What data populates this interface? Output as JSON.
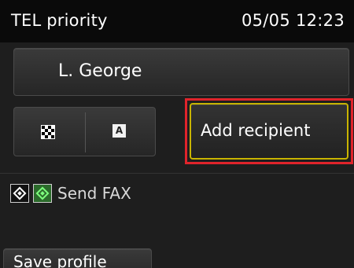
{
  "status_bar": {
    "title": "TEL priority",
    "datetime": "05/05 12:23"
  },
  "recipient": {
    "label": "L. George"
  },
  "scan_modes": {
    "left_icon": "checker-icon",
    "right_icon": "letter-a-icon",
    "right_icon_letter": "A"
  },
  "add_recipient": {
    "label": "Add recipient",
    "highlight_color": "#e0242b",
    "border_color": "#c8b400"
  },
  "send": {
    "black_key_icon": "black-start-key-icon",
    "color_key_icon": "color-start-key-icon",
    "label": "Send FAX"
  },
  "save_profile": {
    "label": "Save profile"
  }
}
